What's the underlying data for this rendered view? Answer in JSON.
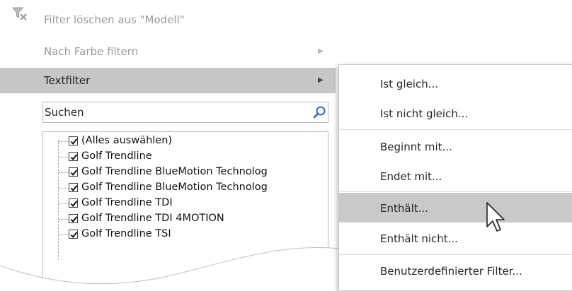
{
  "menu": {
    "clear_filter": "Filter löschen aus \"Modell\"",
    "color_filter": "Nach Farbe filtern",
    "text_filter": "Textfilter",
    "search_placeholder": "Suchen"
  },
  "list": [
    "(Alles auswählen)",
    "Golf Trendline",
    "Golf Trendline BlueMotion Technolog",
    "Golf Trendline BlueMotion Technolog",
    "Golf Trendline TDI",
    "Golf Trendline TDI 4MOTION",
    "Golf Trendline TSI"
  ],
  "submenu": {
    "items": [
      "Ist gleich...",
      "Ist nicht gleich...",
      "Beginnt mit...",
      "Endet mit...",
      "Enthält...",
      "Enthält nicht...",
      "Benutzerdefinierter Filter..."
    ],
    "highlighted_index": 4
  },
  "colors": {
    "highlight": "#c6c6c6",
    "disabled_text": "#9a9a9a",
    "search_icon": "#1e6fc7"
  }
}
